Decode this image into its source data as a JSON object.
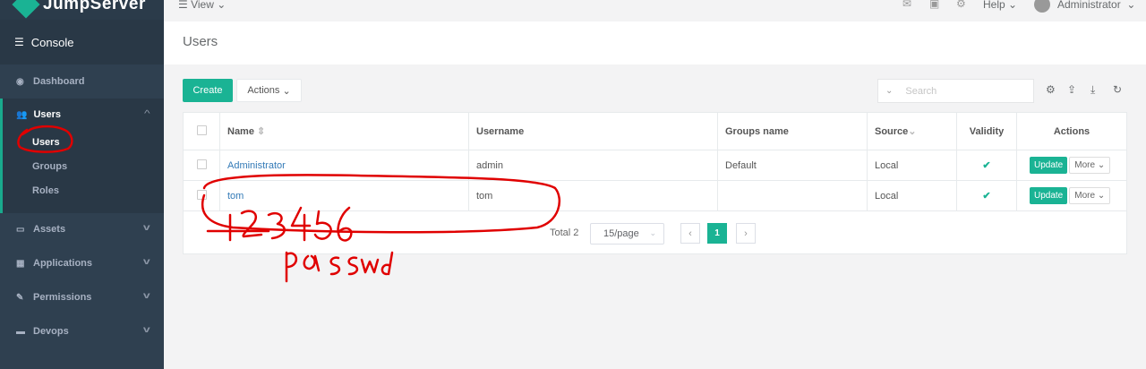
{
  "brand": {
    "name": "JumpServer"
  },
  "sidebar": {
    "console": "Console",
    "dashboard": "Dashboard",
    "users_group": "Users",
    "users_sub": [
      {
        "label": "Users"
      },
      {
        "label": "Groups"
      },
      {
        "label": "Roles"
      }
    ],
    "assets": "Assets",
    "applications": "Applications",
    "permissions": "Permissions",
    "devops": "Devops"
  },
  "topbar": {
    "view": "View",
    "help": "Help",
    "user": "Administrator"
  },
  "page": {
    "title": "Users"
  },
  "toolbar": {
    "create": "Create",
    "actions": "Actions",
    "search_placeholder": "Search"
  },
  "table": {
    "headers": {
      "name": "Name",
      "username": "Username",
      "groups": "Groups name",
      "source": "Source",
      "validity": "Validity",
      "actions": "Actions"
    },
    "rows": [
      {
        "name": "Administrator",
        "username": "admin",
        "groups": "Default",
        "source": "Local",
        "validity": "✔",
        "update": "Update",
        "more": "More"
      },
      {
        "name": "tom",
        "username": "tom",
        "groups": "",
        "source": "Local",
        "validity": "✔",
        "update": "Update",
        "more": "More"
      }
    ]
  },
  "pagination": {
    "total": "Total 2",
    "page_size": "15/page",
    "current": "1"
  },
  "annotation": {
    "digits": "123456",
    "word": "passwd",
    "color": "#e00000"
  },
  "colors": {
    "accent": "#1ab394",
    "sidebar": "#2f4050",
    "link": "#337ab7"
  }
}
